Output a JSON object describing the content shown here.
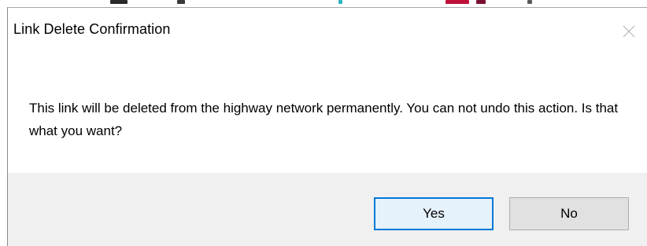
{
  "dialog": {
    "title": "Link Delete Confirmation",
    "message": "This link will be deleted from the highway network permanently. You can not undo this action. Is that what you want?",
    "buttons": {
      "yes_label": "Yes",
      "no_label": "No"
    },
    "default_button": "yes"
  },
  "colors": {
    "accent": "#0078d7",
    "footer_background": "#f0f0f0",
    "button_background": "#e1e1e1"
  },
  "icons": {
    "close": "close-icon"
  }
}
